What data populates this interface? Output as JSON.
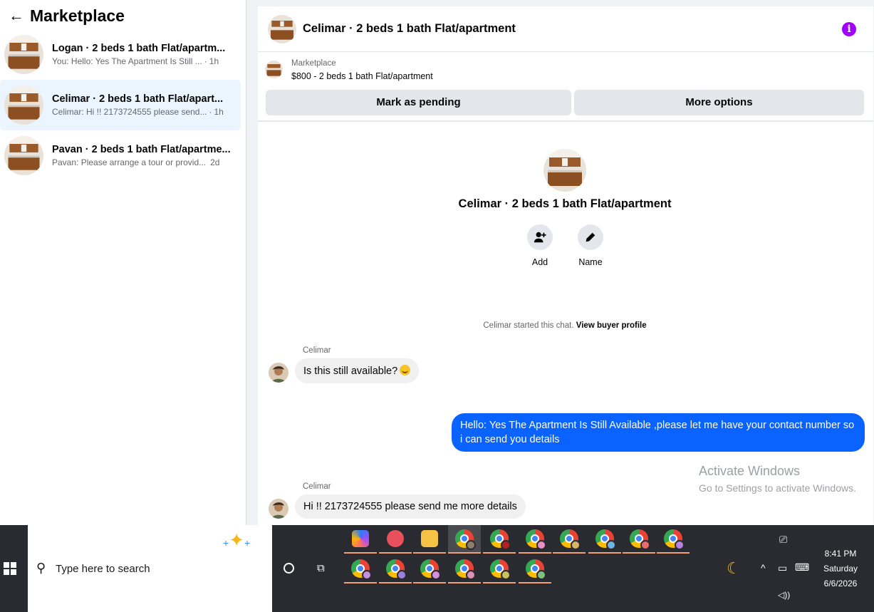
{
  "sidebar": {
    "title": "Marketplace",
    "conversations": [
      {
        "title": "Logan · 2 beds 1 bath Flat/apartm...",
        "preview": "You: Hello: Yes The Apartment Is Still ...",
        "time": "1h"
      },
      {
        "title": "Celimar · 2 beds 1 bath Flat/apart...",
        "preview": "Celimar: Hi !! 2173724555 please send...",
        "time": "1h"
      },
      {
        "title": "Pavan · 2 beds 1 bath Flat/apartme...",
        "preview": "Pavan: Please arrange a tour or provid...",
        "time": "2d"
      }
    ]
  },
  "chat": {
    "header_title": "Celimar · 2 beds 1 bath Flat/apartment",
    "listing": {
      "source": "Marketplace",
      "price_title": "$800 - 2 beds 1 bath Flat/apartment",
      "pending_label": "Mark as pending",
      "more_label": "More options"
    },
    "profile": {
      "name": "Celimar · 2 beds 1 bath Flat/apartment",
      "add_label": "Add",
      "name_label": "Name"
    },
    "started_text": "Celimar started this chat.",
    "view_profile": "View buyer profile",
    "messages": [
      {
        "sender": "Celimar",
        "text": "Is this still available?"
      },
      {
        "text": "Hello: Yes The Apartment Is Still Available ,please let me have your contact number so i can send you details"
      },
      {
        "sender": "Celimar",
        "text": "Hi !! 2173724555 please send me more details"
      }
    ]
  },
  "watermark": {
    "line1": "Activate Windows",
    "line2": "Go to Settings to activate Windows."
  },
  "taskbar": {
    "search_placeholder": "Type here to search",
    "time": "8:41 PM",
    "day": "Saturday",
    "date": "6/6/2026"
  },
  "colors": {
    "accent": "#0a62ff",
    "info": "#a100ff",
    "active_conversation": "#ebf5ff"
  }
}
